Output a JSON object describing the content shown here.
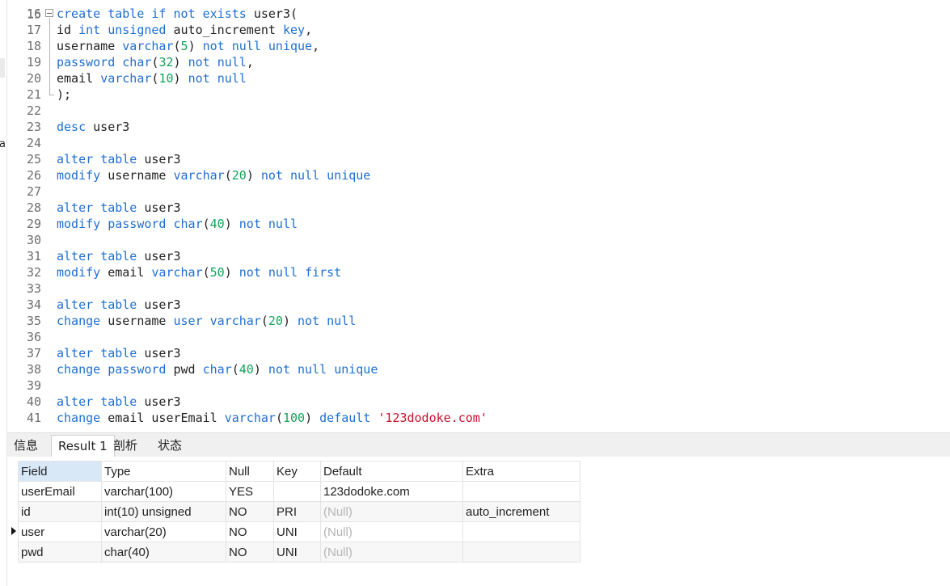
{
  "stray_char": "a",
  "editor": {
    "lines": [
      {
        "n": "16",
        "fold": "start",
        "tokens": [
          [
            "kw",
            "create"
          ],
          [
            "sp",
            " "
          ],
          [
            "kw",
            "table"
          ],
          [
            "sp",
            " "
          ],
          [
            "kw",
            "if"
          ],
          [
            "sp",
            " "
          ],
          [
            "kw",
            "not"
          ],
          [
            "sp",
            " "
          ],
          [
            "kw",
            "exists"
          ],
          [
            "sp",
            " "
          ],
          [
            "id",
            "user3("
          ]
        ]
      },
      {
        "n": "17",
        "fold": "mid",
        "tokens": [
          [
            "id",
            "id"
          ],
          [
            "sp",
            " "
          ],
          [
            "kw",
            "int"
          ],
          [
            "sp",
            " "
          ],
          [
            "kw",
            "unsigned"
          ],
          [
            "sp",
            " "
          ],
          [
            "id",
            "auto_increment"
          ],
          [
            "sp",
            " "
          ],
          [
            "kw",
            "key"
          ],
          [
            "id",
            ","
          ]
        ]
      },
      {
        "n": "18",
        "fold": "mid",
        "tokens": [
          [
            "id",
            "username"
          ],
          [
            "sp",
            " "
          ],
          [
            "kw",
            "varchar"
          ],
          [
            "id",
            "("
          ],
          [
            "num",
            "5"
          ],
          [
            "id",
            ")"
          ],
          [
            "sp",
            " "
          ],
          [
            "kw",
            "not"
          ],
          [
            "sp",
            " "
          ],
          [
            "kw",
            "null"
          ],
          [
            "sp",
            " "
          ],
          [
            "kw",
            "unique"
          ],
          [
            "id",
            ","
          ]
        ]
      },
      {
        "n": "19",
        "fold": "mid",
        "tokens": [
          [
            "kw",
            "password"
          ],
          [
            "sp",
            " "
          ],
          [
            "kw",
            "char"
          ],
          [
            "id",
            "("
          ],
          [
            "num",
            "32"
          ],
          [
            "id",
            ")"
          ],
          [
            "sp",
            " "
          ],
          [
            "kw",
            "not"
          ],
          [
            "sp",
            " "
          ],
          [
            "kw",
            "null"
          ],
          [
            "id",
            ","
          ]
        ]
      },
      {
        "n": "20",
        "fold": "mid",
        "tokens": [
          [
            "id",
            "email"
          ],
          [
            "sp",
            " "
          ],
          [
            "kw",
            "varchar"
          ],
          [
            "id",
            "("
          ],
          [
            "num",
            "10"
          ],
          [
            "id",
            ")"
          ],
          [
            "sp",
            " "
          ],
          [
            "kw",
            "not"
          ],
          [
            "sp",
            " "
          ],
          [
            "kw",
            "null"
          ]
        ]
      },
      {
        "n": "21",
        "fold": "end",
        "tokens": [
          [
            "id",
            ");"
          ]
        ]
      },
      {
        "n": "22",
        "tokens": []
      },
      {
        "n": "23",
        "tokens": [
          [
            "kw",
            "desc"
          ],
          [
            "sp",
            " "
          ],
          [
            "id",
            "user3"
          ]
        ]
      },
      {
        "n": "24",
        "tokens": []
      },
      {
        "n": "25",
        "tokens": [
          [
            "kw",
            "alter"
          ],
          [
            "sp",
            " "
          ],
          [
            "kw",
            "table"
          ],
          [
            "sp",
            " "
          ],
          [
            "id",
            "user3"
          ]
        ]
      },
      {
        "n": "26",
        "tokens": [
          [
            "kw",
            "modify"
          ],
          [
            "sp",
            " "
          ],
          [
            "id",
            "username"
          ],
          [
            "sp",
            " "
          ],
          [
            "kw",
            "varchar"
          ],
          [
            "id",
            "("
          ],
          [
            "num",
            "20"
          ],
          [
            "id",
            ")"
          ],
          [
            "sp",
            " "
          ],
          [
            "kw",
            "not"
          ],
          [
            "sp",
            " "
          ],
          [
            "kw",
            "null"
          ],
          [
            "sp",
            " "
          ],
          [
            "kw",
            "unique"
          ]
        ]
      },
      {
        "n": "27",
        "tokens": []
      },
      {
        "n": "28",
        "tokens": [
          [
            "kw",
            "alter"
          ],
          [
            "sp",
            " "
          ],
          [
            "kw",
            "table"
          ],
          [
            "sp",
            " "
          ],
          [
            "id",
            "user3"
          ]
        ]
      },
      {
        "n": "29",
        "tokens": [
          [
            "kw",
            "modify"
          ],
          [
            "sp",
            " "
          ],
          [
            "kw",
            "password"
          ],
          [
            "sp",
            " "
          ],
          [
            "kw",
            "char"
          ],
          [
            "id",
            "("
          ],
          [
            "num",
            "40"
          ],
          [
            "id",
            ")"
          ],
          [
            "sp",
            " "
          ],
          [
            "kw",
            "not"
          ],
          [
            "sp",
            " "
          ],
          [
            "kw",
            "null"
          ]
        ]
      },
      {
        "n": "30",
        "tokens": []
      },
      {
        "n": "31",
        "tokens": [
          [
            "kw",
            "alter"
          ],
          [
            "sp",
            " "
          ],
          [
            "kw",
            "table"
          ],
          [
            "sp",
            " "
          ],
          [
            "id",
            "user3"
          ]
        ]
      },
      {
        "n": "32",
        "tokens": [
          [
            "kw",
            "modify"
          ],
          [
            "sp",
            " "
          ],
          [
            "id",
            "email"
          ],
          [
            "sp",
            " "
          ],
          [
            "kw",
            "varchar"
          ],
          [
            "id",
            "("
          ],
          [
            "num",
            "50"
          ],
          [
            "id",
            ")"
          ],
          [
            "sp",
            " "
          ],
          [
            "kw",
            "not"
          ],
          [
            "sp",
            " "
          ],
          [
            "kw",
            "null"
          ],
          [
            "sp",
            " "
          ],
          [
            "kw",
            "first"
          ]
        ]
      },
      {
        "n": "33",
        "tokens": []
      },
      {
        "n": "34",
        "tokens": [
          [
            "kw",
            "alter"
          ],
          [
            "sp",
            " "
          ],
          [
            "kw",
            "table"
          ],
          [
            "sp",
            " "
          ],
          [
            "id",
            "user3"
          ]
        ]
      },
      {
        "n": "35",
        "tokens": [
          [
            "kw",
            "change"
          ],
          [
            "sp",
            " "
          ],
          [
            "id",
            "username"
          ],
          [
            "sp",
            " "
          ],
          [
            "kw",
            "user"
          ],
          [
            "sp",
            " "
          ],
          [
            "kw",
            "varchar"
          ],
          [
            "id",
            "("
          ],
          [
            "num",
            "20"
          ],
          [
            "id",
            ")"
          ],
          [
            "sp",
            " "
          ],
          [
            "kw",
            "not"
          ],
          [
            "sp",
            " "
          ],
          [
            "kw",
            "null"
          ]
        ]
      },
      {
        "n": "36",
        "tokens": []
      },
      {
        "n": "37",
        "tokens": [
          [
            "kw",
            "alter"
          ],
          [
            "sp",
            " "
          ],
          [
            "kw",
            "table"
          ],
          [
            "sp",
            " "
          ],
          [
            "id",
            "user3"
          ]
        ]
      },
      {
        "n": "38",
        "tokens": [
          [
            "kw",
            "change"
          ],
          [
            "sp",
            " "
          ],
          [
            "kw",
            "password"
          ],
          [
            "sp",
            " "
          ],
          [
            "id",
            "pwd"
          ],
          [
            "sp",
            " "
          ],
          [
            "kw",
            "char"
          ],
          [
            "id",
            "("
          ],
          [
            "num",
            "40"
          ],
          [
            "id",
            ")"
          ],
          [
            "sp",
            " "
          ],
          [
            "kw",
            "not"
          ],
          [
            "sp",
            " "
          ],
          [
            "kw",
            "null"
          ],
          [
            "sp",
            " "
          ],
          [
            "kw",
            "unique"
          ]
        ]
      },
      {
        "n": "39",
        "tokens": []
      },
      {
        "n": "40",
        "tokens": [
          [
            "kw",
            "alter"
          ],
          [
            "sp",
            " "
          ],
          [
            "kw",
            "table"
          ],
          [
            "sp",
            " "
          ],
          [
            "id",
            "user3"
          ]
        ]
      },
      {
        "n": "41",
        "tokens": [
          [
            "kw",
            "change"
          ],
          [
            "sp",
            " "
          ],
          [
            "id",
            "email"
          ],
          [
            "sp",
            " "
          ],
          [
            "id",
            "userEmail"
          ],
          [
            "sp",
            " "
          ],
          [
            "kw",
            "varchar"
          ],
          [
            "id",
            "("
          ],
          [
            "num",
            "100"
          ],
          [
            "id",
            ")"
          ],
          [
            "sp",
            " "
          ],
          [
            "kw",
            "default"
          ],
          [
            "sp",
            " "
          ],
          [
            "str",
            "'123dodoke.com'"
          ]
        ]
      }
    ]
  },
  "tabs": [
    {
      "label": "信息",
      "active": false
    },
    {
      "label": "Result 1",
      "active": true
    },
    {
      "label": "剖析",
      "active": false
    },
    {
      "label": "状态",
      "active": false
    }
  ],
  "result": {
    "columns": [
      "Field",
      "Type",
      "Null",
      "Key",
      "Default",
      "Extra"
    ],
    "rows": [
      [
        "userEmail",
        "varchar(100)",
        "YES",
        "",
        "123dodoke.com",
        ""
      ],
      [
        "id",
        "int(10) unsigned",
        "NO",
        "PRI",
        "(Null)",
        "auto_increment"
      ],
      [
        "user",
        "varchar(20)",
        "NO",
        "UNI",
        "(Null)",
        ""
      ],
      [
        "pwd",
        "char(40)",
        "NO",
        "UNI",
        "(Null)",
        ""
      ]
    ],
    "current_row": 2
  }
}
